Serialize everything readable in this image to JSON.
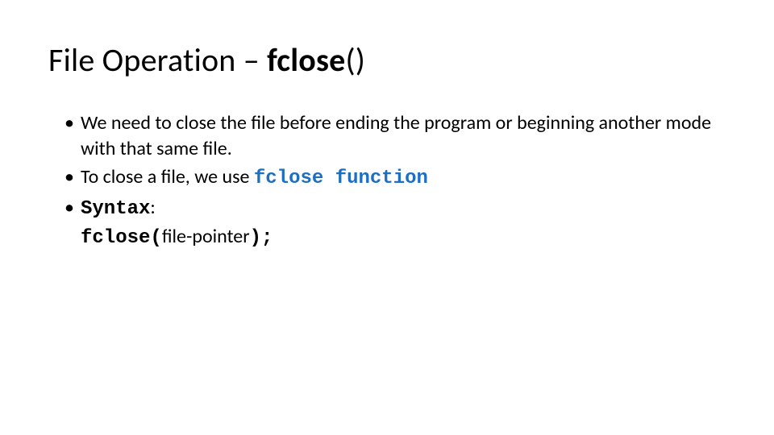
{
  "title": {
    "prefix": "File Operation – ",
    "fn": "fclose",
    "suffix": "()"
  },
  "bullets": {
    "b1": "We need to close the file before ending the program or beginning another mode with that same file.",
    "b2": {
      "lead": "To close a file, we use ",
      "code": "fclose function"
    },
    "b3": {
      "label": "Syntax",
      "colon": ":",
      "code_open": "fclose(",
      "arg": "file-pointer",
      "code_close": ");"
    }
  }
}
